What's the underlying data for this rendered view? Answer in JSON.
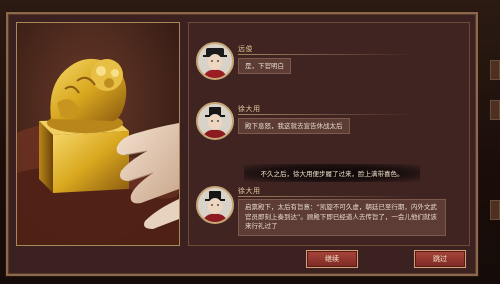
{
  "dialogue": [
    {
      "speaker": "远俊",
      "text": "是，下官明白",
      "avatar_icon": "official-black-hat-avatar"
    },
    {
      "speaker": "徐大用",
      "text": "殿下息怒，我这就去宣告休战太后",
      "avatar_icon": "eunuch-avatar"
    },
    {
      "speaker": "徐大用",
      "text": "启禀殿下，太后有旨意：“凯旋不可久虚，朝廷已至行期，内外文武官员即刻上奏到达”。顾殿下即已经道人去传旨了，一会儿他们就该来行礼过了",
      "avatar_icon": "eunuch-avatar"
    }
  ],
  "narration": "不久之后，徐大用便步履了过来，脸上满带喜色。",
  "buttons": {
    "continue": "继续",
    "skip": "跳过"
  },
  "illustration": {
    "subject": "golden-imperial-seal",
    "colors": {
      "gold": "#d9a81f",
      "gold_light": "#f6d86a",
      "cloth": "#7a3a24"
    }
  }
}
